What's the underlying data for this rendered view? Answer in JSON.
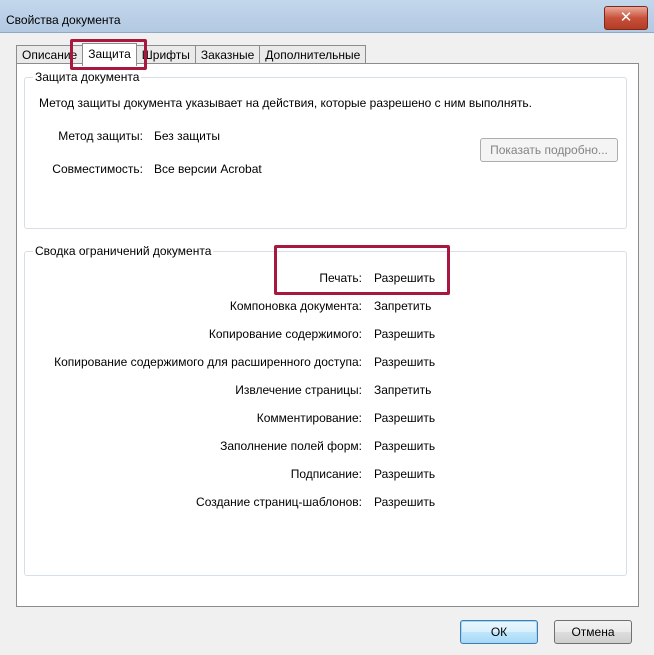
{
  "window": {
    "title": "Свойства документа",
    "close_glyph": "✕"
  },
  "tabs": [
    {
      "label": "Описание",
      "active": false
    },
    {
      "label": "Защита",
      "active": true
    },
    {
      "label": "Шрифты",
      "active": false
    },
    {
      "label": "Заказные",
      "active": false
    },
    {
      "label": "Дополнительные",
      "active": false
    }
  ],
  "security": {
    "group_title": "Защита документа",
    "description": "Метод защиты документа указывает на действия, которые разрешено с ним выполнять.",
    "method_label": "Метод защиты:",
    "method_value": "Без защиты",
    "compat_label": "Совместимость:",
    "compat_value": "Все версии Acrobat",
    "details_button": "Показать подробно..."
  },
  "restrictions": {
    "group_title": "Сводка ограничений документа",
    "rows": [
      {
        "label": "Печать:",
        "value": "Разрешить"
      },
      {
        "label": "Компоновка документа:",
        "value": "Запретить"
      },
      {
        "label": "Копирование содержимого:",
        "value": "Разрешить"
      },
      {
        "label": "Копирование содержимого для расширенного доступа:",
        "value": "Разрешить"
      },
      {
        "label": "Извлечение страницы:",
        "value": "Запретить"
      },
      {
        "label": "Комментирование:",
        "value": "Разрешить"
      },
      {
        "label": "Заполнение полей форм:",
        "value": "Разрешить"
      },
      {
        "label": "Подписание:",
        "value": "Разрешить"
      },
      {
        "label": "Создание страниц-шаблонов:",
        "value": "Разрешить"
      }
    ]
  },
  "footer": {
    "ok": "ОК",
    "cancel": "Отмена"
  },
  "colors": {
    "highlight": "#a8173e"
  }
}
